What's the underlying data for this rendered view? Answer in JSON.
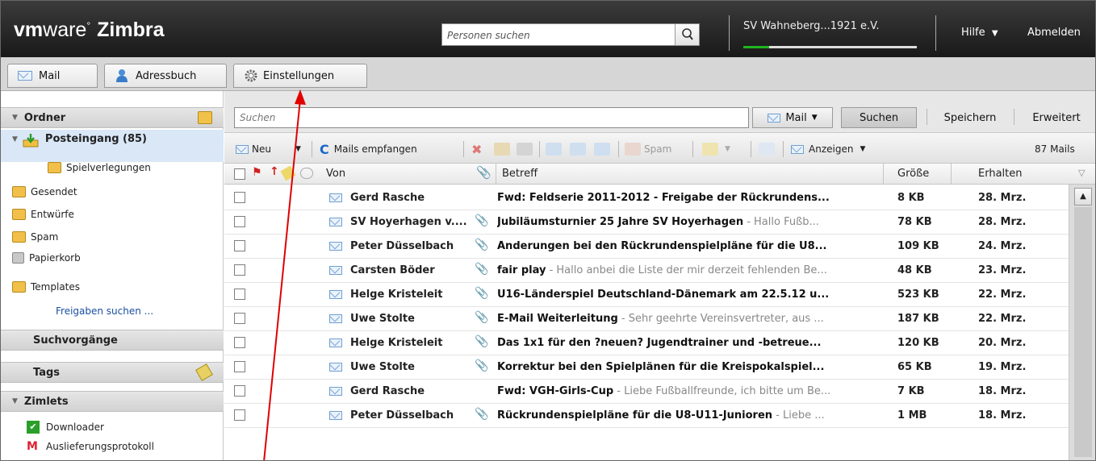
{
  "brand": {
    "vm": "vm",
    "ware": "ware",
    "suffix": "Zimbra"
  },
  "topbar": {
    "people_search_placeholder": "Personen suchen",
    "account_name": "SV Wahneberg...1921 e.V.",
    "quota_fraction": 0.15,
    "help_label": "Hilfe",
    "logout_label": "Abmelden"
  },
  "app_tabs": [
    {
      "label": "Mail",
      "icon": "mail-icon"
    },
    {
      "label": "Adressbuch",
      "icon": "contact-icon"
    },
    {
      "label": "Einstellungen",
      "icon": "gear-icon"
    }
  ],
  "sidebar": {
    "folders_header": "Ordner",
    "folders": [
      {
        "label": "Posteingang (85)",
        "icon": "inbox-icon",
        "selected": true
      },
      {
        "label": "Spielverlegungen",
        "icon": "folder-icon"
      },
      {
        "label": "Gesendet",
        "icon": "sent-icon"
      },
      {
        "label": "Entwürfe",
        "icon": "drafts-icon"
      },
      {
        "label": "Spam",
        "icon": "spam-icon"
      },
      {
        "label": "Papierkorb",
        "icon": "trash-icon"
      },
      {
        "label": "Templates",
        "icon": "folder-icon"
      }
    ],
    "find_shares": "Freigaben suchen ...",
    "searches_header": "Suchvorgänge",
    "tags_header": "Tags",
    "zimlets_header": "Zimlets",
    "zimlets": [
      {
        "label": "Downloader",
        "icon": "downloader-icon"
      },
      {
        "label": "Auslieferungsprotokoll",
        "icon": "gmail-icon"
      }
    ]
  },
  "search": {
    "placeholder": "Suchen",
    "type_label": "Mail",
    "search_button": "Suchen",
    "save_button": "Speichern",
    "advanced_button": "Erweitert"
  },
  "toolbar": {
    "new_label": "Neu",
    "fetch_label": "Mails empfangen",
    "spam_label": "Spam",
    "view_label": "Anzeigen",
    "count_label": "87 Mails"
  },
  "columns": {
    "from": "Von",
    "subject": "Betreff",
    "size": "Größe",
    "received": "Erhalten"
  },
  "messages": [
    {
      "from": "Gerd Rasche",
      "attach": false,
      "subject": "Fwd: Feldserie 2011-2012 - Freigabe der Rückrundens...",
      "fragment": "",
      "size": "8 KB",
      "date": "28. Mrz."
    },
    {
      "from": "SV Hoyerhagen v....",
      "attach": true,
      "subject": "Jubiläumsturnier 25 Jahre SV Hoyerhagen",
      "fragment": " - Hallo Fußb...",
      "size": "78 KB",
      "date": "28. Mrz."
    },
    {
      "from": "Peter Düsselbach",
      "attach": true,
      "subject": "Änderungen bei den Rückrundenspielpläne für die U8...",
      "fragment": "",
      "size": "109 KB",
      "date": "24. Mrz."
    },
    {
      "from": "Carsten Böder",
      "attach": true,
      "subject": "fair play",
      "fragment": " - Hallo anbei die Liste der mir derzeit fehlenden Be...",
      "size": "48 KB",
      "date": "23. Mrz."
    },
    {
      "from": "Helge Kristeleit",
      "attach": true,
      "subject": "U16-Länderspiel Deutschland-Dänemark am 22.5.12 u...",
      "fragment": "",
      "size": "523 KB",
      "date": "22. Mrz."
    },
    {
      "from": "Uwe Stolte",
      "attach": true,
      "subject": "E-Mail Weiterleitung",
      "fragment": " - Sehr geehrte Vereinsvertreter, aus ...",
      "size": "187 KB",
      "date": "22. Mrz."
    },
    {
      "from": "Helge Kristeleit",
      "attach": true,
      "subject": "Das 1x1 für den ?neuen? Jugendtrainer und -betreue...",
      "fragment": "",
      "size": "120 KB",
      "date": "20. Mrz."
    },
    {
      "from": "Uwe Stolte",
      "attach": true,
      "subject": "Korrektur bei den Spielplänen für die Kreispokalspiel...",
      "fragment": "",
      "size": "65 KB",
      "date": "19. Mrz."
    },
    {
      "from": "Gerd Rasche",
      "attach": false,
      "subject": "Fwd: VGH-Girls-Cup",
      "fragment": " - Liebe Fußballfreunde, ich bitte um Be...",
      "size": "7 KB",
      "date": "18. Mrz."
    },
    {
      "from": "Peter Düsselbach",
      "attach": true,
      "subject": "Rückrundenspielpläne für die U8-U11-Junioren",
      "fragment": " - Liebe ...",
      "size": "1 MB",
      "date": "18. Mrz."
    }
  ],
  "colors": {
    "arrow": "#e00000",
    "accent_selection": "#d9e7f7",
    "quota_fill": "#1fb51f"
  }
}
